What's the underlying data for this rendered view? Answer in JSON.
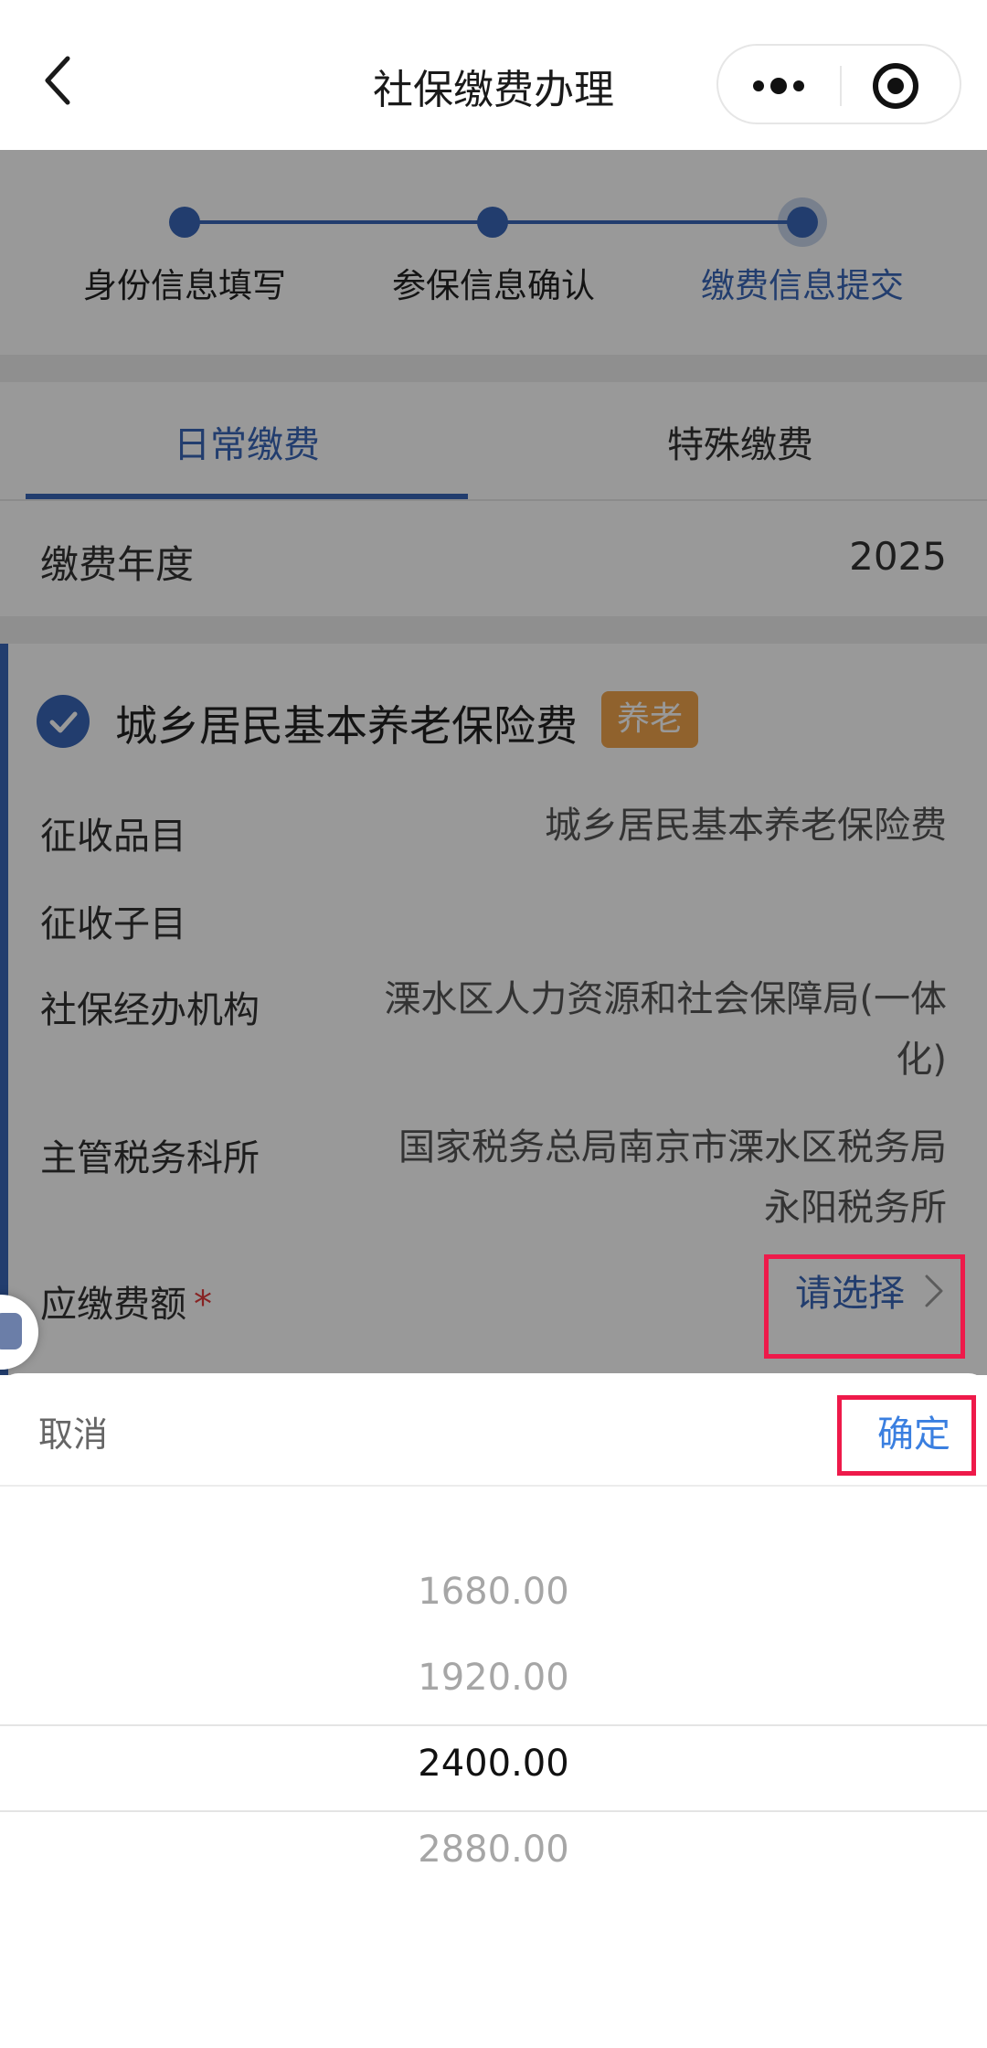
{
  "header": {
    "title": "社保缴费办理"
  },
  "steps": [
    {
      "label": "身份信息填写",
      "state": "done"
    },
    {
      "label": "参保信息确认",
      "state": "done"
    },
    {
      "label": "缴费信息提交",
      "state": "active"
    }
  ],
  "tabs": [
    {
      "label": "日常缴费",
      "active": true
    },
    {
      "label": "特殊缴费",
      "active": false
    }
  ],
  "year": {
    "label": "缴费年度",
    "value": "2025"
  },
  "card": {
    "title": "城乡居民基本养老保险费",
    "badge": "养老",
    "rows": [
      {
        "label": "征收品目",
        "value": "城乡居民基本养老保险费"
      },
      {
        "label": "征收子目",
        "value": ""
      },
      {
        "label": "社保经办机构",
        "value_line1": "溧水区人力资源和社会保障局(一体",
        "value_line2": "化)"
      },
      {
        "label": "主管税务科所",
        "value_line1": "国家税务总局南京市溧水区税务局",
        "value_line2": "永阳税务所"
      }
    ],
    "amount_label": "应缴费额",
    "required_mark": "*",
    "amount_select": "请选择"
  },
  "picker": {
    "cancel_label": "取消",
    "confirm_label": "确定",
    "options": [
      "1680.00",
      "1920.00",
      "2400.00",
      "2880.00"
    ],
    "selected": "2400.00"
  },
  "colors": {
    "accent": "#3a67b7",
    "badge": "#f0a44c",
    "confirm": "#3a7fe0",
    "highlight": "#ee1a4a",
    "required": "#e23b3b"
  }
}
